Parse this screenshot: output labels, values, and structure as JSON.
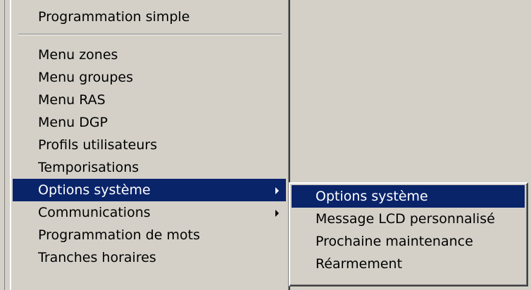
{
  "menu": {
    "top_item": "Programmation simple",
    "items": [
      {
        "label": "Menu zones",
        "has_submenu": false
      },
      {
        "label": "Menu groupes",
        "has_submenu": false
      },
      {
        "label": "Menu RAS",
        "has_submenu": false
      },
      {
        "label": "Menu DGP",
        "has_submenu": false
      },
      {
        "label": "Profils utilisateurs",
        "has_submenu": false
      },
      {
        "label": "Temporisations",
        "has_submenu": false
      },
      {
        "label": "Options système",
        "has_submenu": true,
        "selected": true
      },
      {
        "label": "Communications",
        "has_submenu": true
      },
      {
        "label": "Programmation de mots",
        "has_submenu": false
      },
      {
        "label": "Tranches horaires",
        "has_submenu": false
      }
    ]
  },
  "submenu": {
    "items": [
      {
        "label": "Options système",
        "selected": true
      },
      {
        "label": "Message LCD personnalisé"
      },
      {
        "label": "Prochaine maintenance"
      },
      {
        "label": "Réarmement"
      }
    ]
  },
  "colors": {
    "menu_background": "#d4d0c8",
    "highlight": "#0a246a",
    "highlight_text": "#ffffff"
  }
}
